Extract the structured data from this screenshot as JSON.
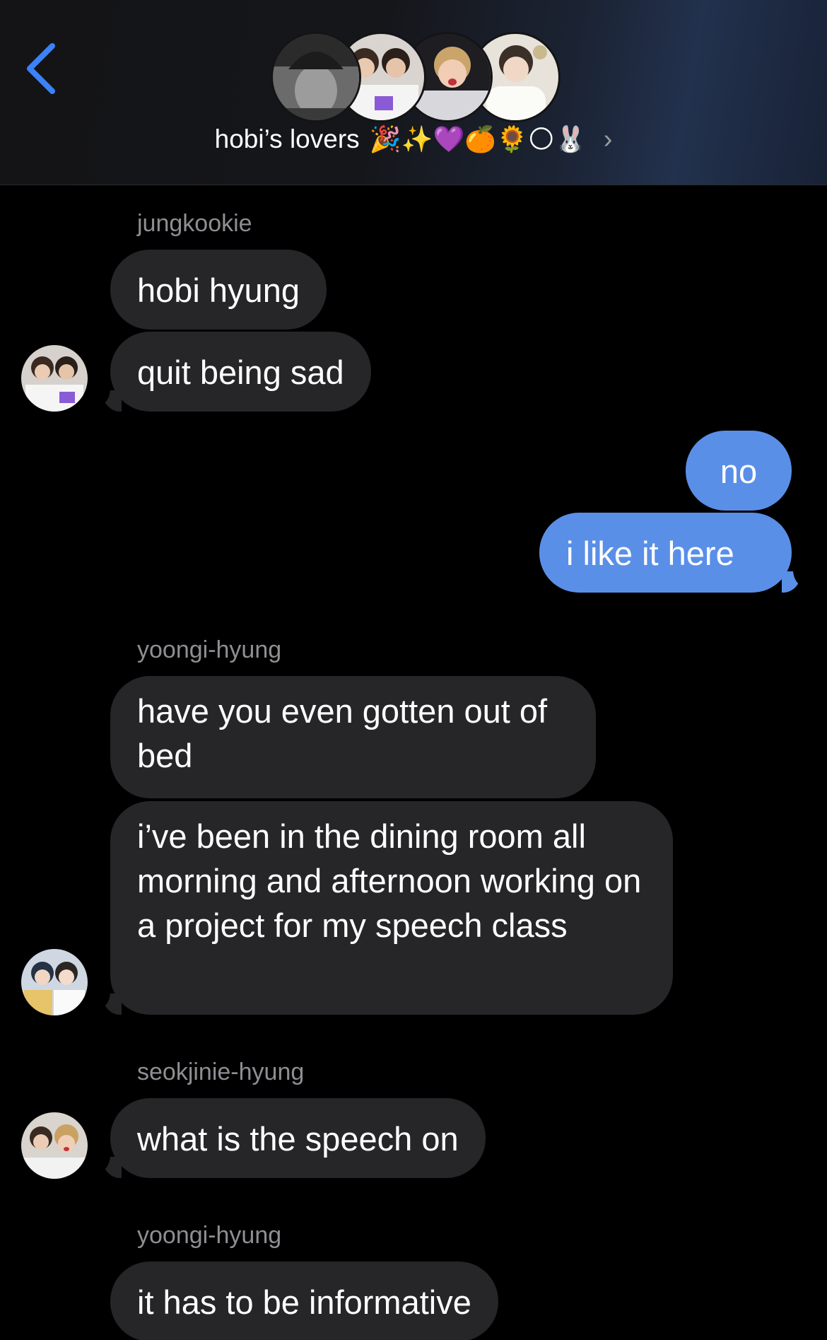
{
  "header": {
    "back_icon": "chevron-left-icon",
    "group_name": "hobi’s lovers",
    "group_emojis": "🎉✨💜🍊🌻🌕🐰",
    "chevron": "›",
    "member_avatar_count": 4
  },
  "colors": {
    "incoming_bubble": "#262629",
    "outgoing_bubble": "#5a8fe8",
    "accent_back": "#3b82f6",
    "sender_label": "#8e8e93"
  },
  "messages": [
    {
      "sender": "jungkookie",
      "text": "hobi hyung"
    },
    {
      "text": "quit being sad"
    },
    {
      "outgoing": true,
      "text": "no"
    },
    {
      "outgoing": true,
      "text": "i like it here"
    },
    {
      "sender": "yoongi-hyung",
      "text": "have you even gotten out of bed"
    },
    {
      "text": "i’ve been in the dining room all morning and afternoon working on a project for my speech class"
    },
    {
      "sender": "seokjinie-hyung",
      "text": "what is the speech on"
    },
    {
      "sender": "yoongi-hyung",
      "text": "it has to be informative"
    }
  ]
}
